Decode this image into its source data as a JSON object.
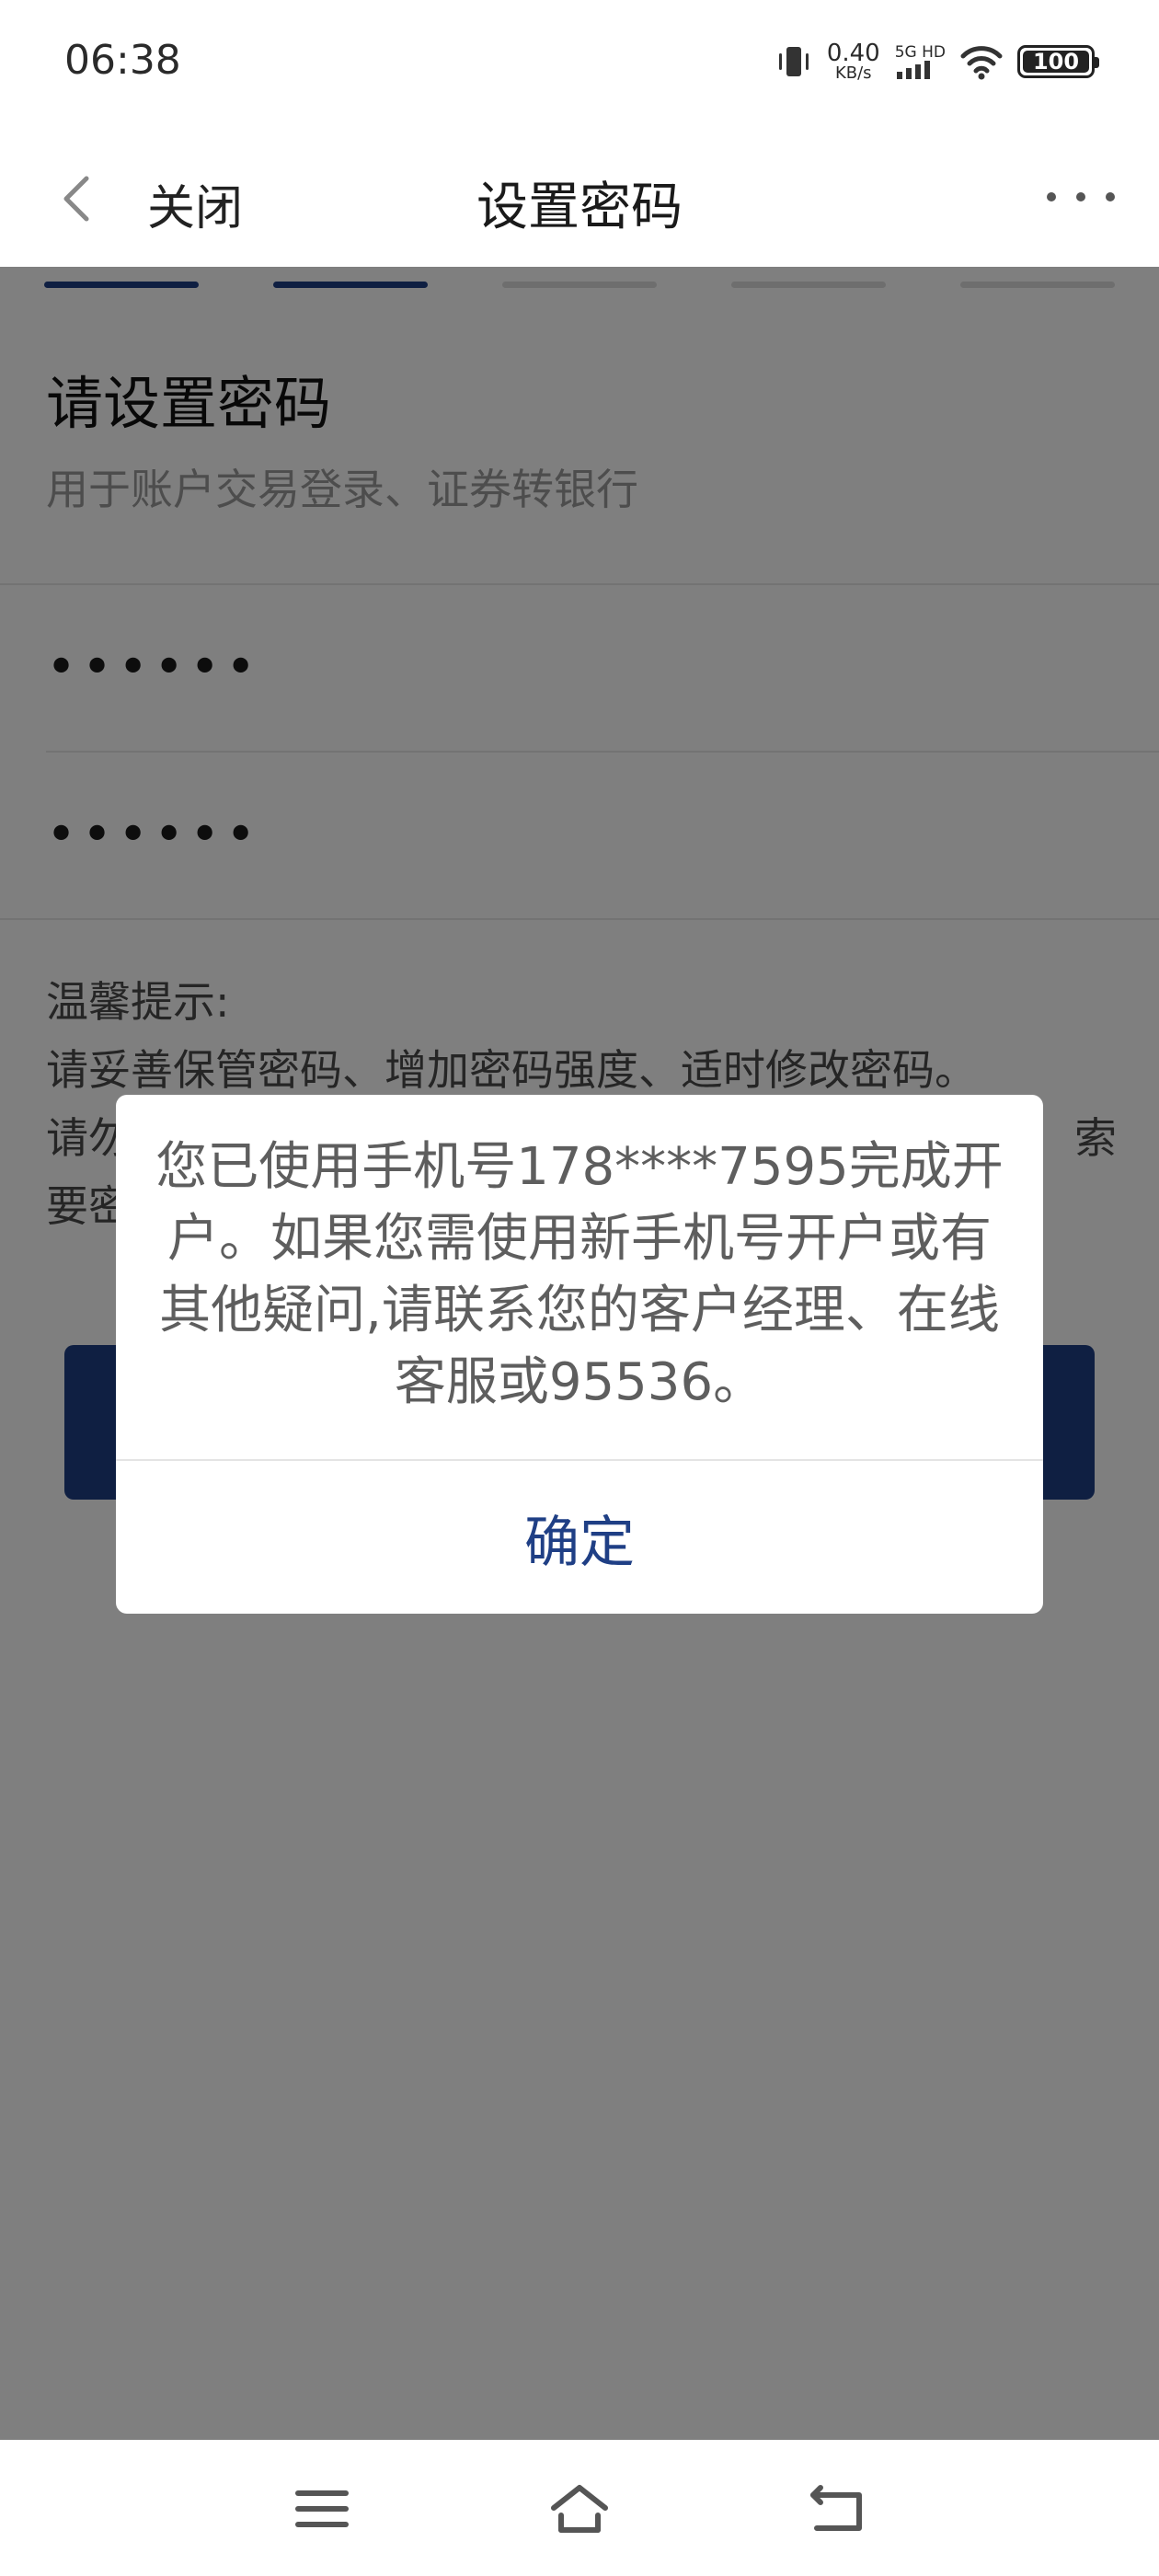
{
  "status_bar": {
    "time": "06:38",
    "net_speed_value": "0.40",
    "net_speed_unit": "KB/s",
    "network_type": "5G HD",
    "battery": "100",
    "icons": [
      "vibrate-icon",
      "signal-icon",
      "wifi-icon",
      "battery-icon"
    ]
  },
  "header": {
    "close_label": "关闭",
    "title": "设置密码",
    "icons": [
      "back-chevron-icon",
      "more-icon"
    ]
  },
  "progress": {
    "total_steps": 5,
    "completed_steps": 2,
    "active_color": "#1f3f85",
    "inactive_color": "#dcdcdc"
  },
  "form": {
    "heading": "请设置密码",
    "subheading": "用于账户交易登录、证券转银行",
    "password_value": "••••••",
    "confirm_password_value": "••••••",
    "tips": {
      "title": "温馨提示:",
      "line1": "请妥善保管密码、增加密码强度、适时修改密码。",
      "line2_prefix": "请勿",
      "line2_suffix": "索",
      "line3_prefix": "要密"
    }
  },
  "dialog": {
    "message": "您已使用手机号178****7595完成开户。如果您需使用新手机号开户或有其他疑问,请联系您的客户经理、在线客服或95536。",
    "confirm_label": "确定"
  },
  "nav_bar": {
    "icons": [
      "menu-icon",
      "home-icon",
      "back-icon"
    ]
  },
  "colors": {
    "brand": "#1f3f85",
    "overlay": "rgba(0,0,0,0.5)"
  }
}
